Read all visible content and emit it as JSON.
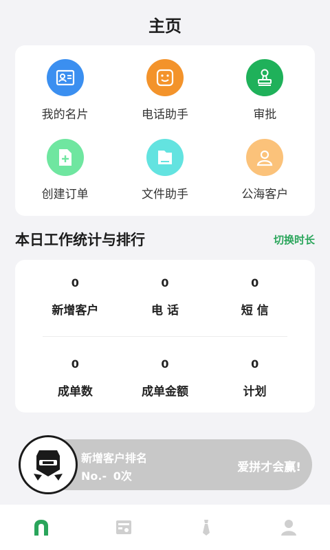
{
  "header": {
    "title": "主页"
  },
  "quick_actions": [
    {
      "label": "我的名片",
      "icon": "business-card-icon",
      "color": "#3b8ff0"
    },
    {
      "label": "电话助手",
      "icon": "phone-assistant-icon",
      "color": "#f3932b"
    },
    {
      "label": "审批",
      "icon": "approval-stamp-icon",
      "color": "#1fb15a"
    },
    {
      "label": "创建订单",
      "icon": "create-order-icon",
      "color": "#6fe6a0"
    },
    {
      "label": "文件助手",
      "icon": "file-assistant-icon",
      "color": "#63e3e0"
    },
    {
      "label": "公海客户",
      "icon": "public-customer-icon",
      "color": "#fbc27a"
    }
  ],
  "stats_section": {
    "title": "本日工作统计与排行",
    "switch_label": "切换时长",
    "accent": "#2aa55b"
  },
  "stats": [
    {
      "value": "0",
      "label": "新增客户"
    },
    {
      "value": "0",
      "label": "电 话"
    },
    {
      "value": "0",
      "label": "短 信"
    },
    {
      "value": "0",
      "label": "成单数"
    },
    {
      "value": "0",
      "label": "成单金额"
    },
    {
      "value": "0",
      "label": "计划"
    }
  ],
  "ranking": {
    "title": "新增客户排名",
    "rank_label": "No.-",
    "count_label": "0次",
    "slogan": "爱拼才会赢!",
    "badge_icon": "ninja-badge-icon"
  },
  "tabbar": [
    {
      "name": "home",
      "icon": "home-icon",
      "active": true
    },
    {
      "name": "dashboard",
      "icon": "dashboard-icon",
      "active": false
    },
    {
      "name": "tie",
      "icon": "tie-icon",
      "active": false
    },
    {
      "name": "profile",
      "icon": "person-icon",
      "active": false
    }
  ],
  "colors": {
    "active_tab": "#2aa55b",
    "inactive_tab": "#cfcfcf"
  }
}
